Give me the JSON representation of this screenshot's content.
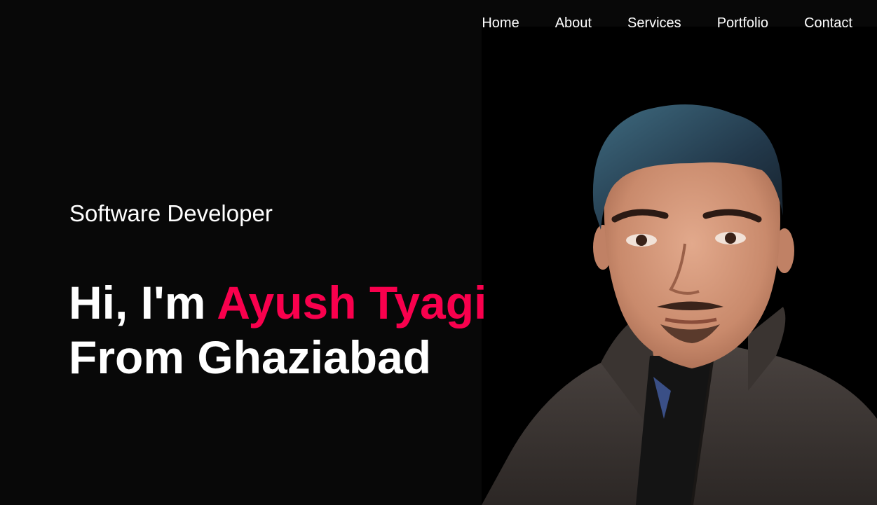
{
  "nav": {
    "items": [
      "Home",
      "About",
      "Services",
      "Portfolio",
      "Contact"
    ]
  },
  "hero": {
    "subtitle": "Software Developer",
    "greeting": "Hi, I'm",
    "name": "Ayush Tyagi",
    "location_line": "From Ghaziabad"
  },
  "colors": {
    "background": "#080808",
    "accent": "#f9004d",
    "text": "#ffffff"
  },
  "image": {
    "alt": "portrait-photo"
  }
}
